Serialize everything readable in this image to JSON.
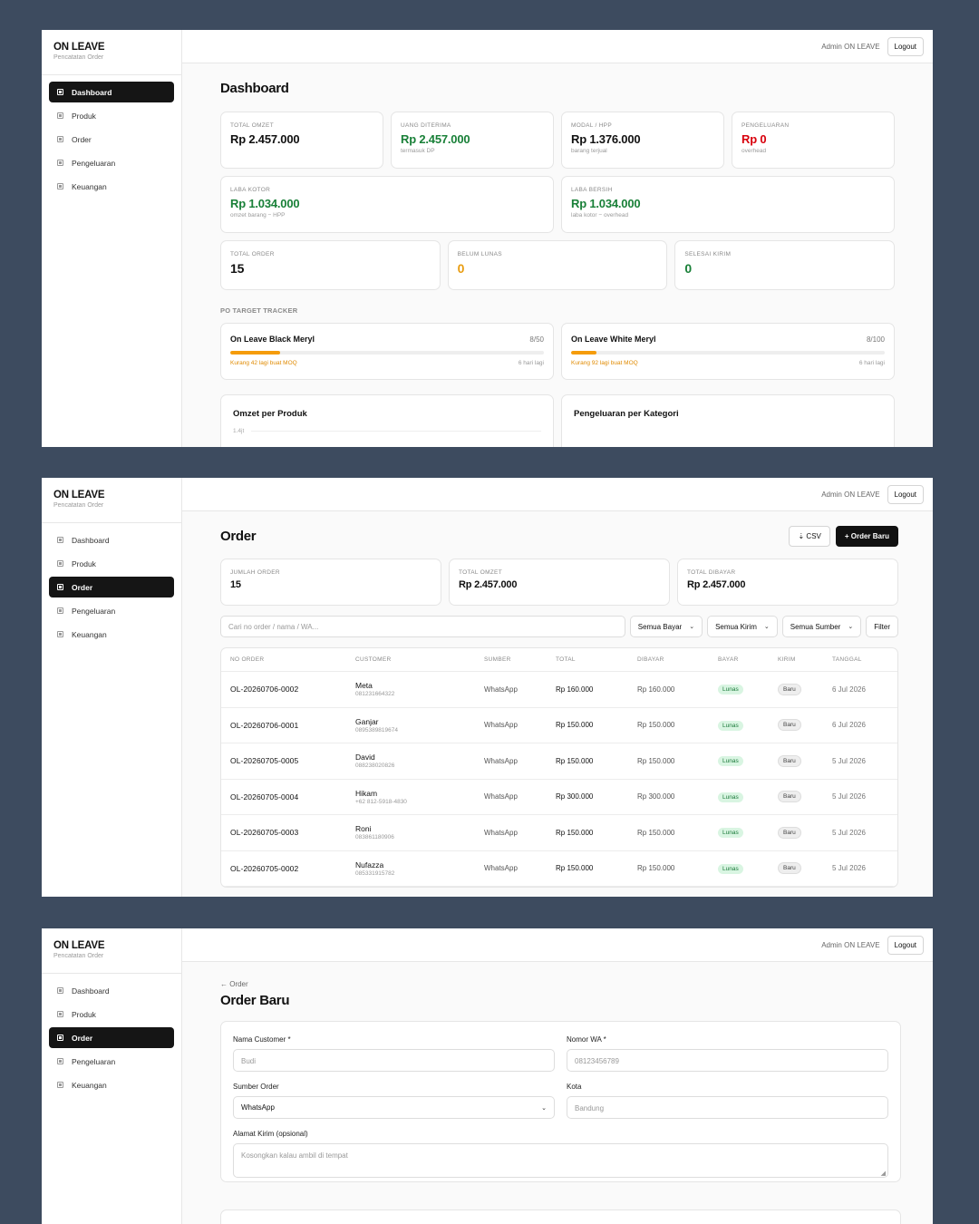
{
  "brand": {
    "name": "ON LEAVE",
    "subtitle": "Pencatatan Order"
  },
  "nav": [
    "Dashboard",
    "Produk",
    "Order",
    "Pengeluaran",
    "Keuangan"
  ],
  "topbar": {
    "admin": "Admin ON LEAVE",
    "logout": "Logout"
  },
  "dashboard": {
    "title": "Dashboard",
    "stats_row1": [
      {
        "label": "TOTAL OMZET",
        "value": "Rp 2.457.000",
        "sub": "",
        "color": "#111111"
      },
      {
        "label": "UANG DITERIMA",
        "value": "Rp 2.457.000",
        "sub": "termasuk DP",
        "color": "#198038"
      },
      {
        "label": "MODAL / HPP",
        "value": "Rp 1.376.000",
        "sub": "barang terjual",
        "color": "#111111"
      },
      {
        "label": "PENGELUARAN",
        "value": "Rp 0",
        "sub": "overhead",
        "color": "#d8000c"
      }
    ],
    "stats_row2": [
      {
        "label": "LABA KOTOR",
        "value": "Rp 1.034.000",
        "sub": "omzet barang − HPP",
        "color": "#198038"
      },
      {
        "label": "LABA BERSIH",
        "value": "Rp 1.034.000",
        "sub": "laba kotor − overhead",
        "color": "#198038"
      }
    ],
    "stats_row3": [
      {
        "label": "TOTAL ORDER",
        "value": "15",
        "color": "#111111"
      },
      {
        "label": "BELUM LUNAS",
        "value": "0",
        "color": "#e89c10"
      },
      {
        "label": "SELESAI KIRIM",
        "value": "0",
        "color": "#198038"
      }
    ],
    "po_section": "PO TARGET TRACKER",
    "po": [
      {
        "name": "On Leave Black Meryl",
        "count": "8/50",
        "progress": 0.16,
        "note": "Kurang 42 lagi buat MOQ",
        "days": "6 hari lagi"
      },
      {
        "name": "On Leave White Meryl",
        "count": "8/100",
        "progress": 0.08,
        "note": "Kurang 92 lagi buat MOQ",
        "days": "6 hari lagi"
      }
    ],
    "charts": [
      {
        "title": "Omzet per Produk",
        "tick": "1.4jt"
      },
      {
        "title": "Pengeluaran per Kategori",
        "tick": ""
      }
    ]
  },
  "order": {
    "title": "Order",
    "csv": "⇣ CSV",
    "new": "+ Order Baru",
    "stats": [
      {
        "label": "JUMLAH ORDER",
        "value": "15"
      },
      {
        "label": "TOTAL OMZET",
        "value": "Rp 2.457.000"
      },
      {
        "label": "TOTAL DIBAYAR",
        "value": "Rp 2.457.000"
      }
    ],
    "search_placeholder": "Cari no order / nama / WA...",
    "filters": [
      "Semua Bayar",
      "Semua Kirim",
      "Semua Sumber"
    ],
    "filter_button": "Filter",
    "columns": [
      "NO ORDER",
      "CUSTOMER",
      "SUMBER",
      "TOTAL",
      "DIBAYAR",
      "BAYAR",
      "KIRIM",
      "TANGGAL"
    ],
    "rows": [
      {
        "no": "OL-20260706-0002",
        "name": "Meta",
        "phone": "081231664322",
        "source": "WhatsApp",
        "total": "Rp 160.000",
        "paid": "Rp 160.000",
        "pay": "Lunas",
        "ship": "Baru",
        "date": "6 Jul 2026"
      },
      {
        "no": "OL-20260706-0001",
        "name": "Ganjar",
        "phone": "0895389819674",
        "source": "WhatsApp",
        "total": "Rp 150.000",
        "paid": "Rp 150.000",
        "pay": "Lunas",
        "ship": "Baru",
        "date": "6 Jul 2026"
      },
      {
        "no": "OL-20260705-0005",
        "name": "David",
        "phone": "088238020826",
        "source": "WhatsApp",
        "total": "Rp 150.000",
        "paid": "Rp 150.000",
        "pay": "Lunas",
        "ship": "Baru",
        "date": "5 Jul 2026"
      },
      {
        "no": "OL-20260705-0004",
        "name": "Hikam",
        "phone": "+62 812-5918-4830",
        "source": "WhatsApp",
        "total": "Rp 300.000",
        "paid": "Rp 300.000",
        "pay": "Lunas",
        "ship": "Baru",
        "date": "5 Jul 2026"
      },
      {
        "no": "OL-20260705-0003",
        "name": "Roni",
        "phone": "083861180906",
        "source": "WhatsApp",
        "total": "Rp 150.000",
        "paid": "Rp 150.000",
        "pay": "Lunas",
        "ship": "Baru",
        "date": "5 Jul 2026"
      },
      {
        "no": "OL-20260705-0002",
        "name": "Nufazza",
        "phone": "085331915782",
        "source": "WhatsApp",
        "total": "Rp 150.000",
        "paid": "Rp 150.000",
        "pay": "Lunas",
        "ship": "Baru",
        "date": "5 Jul 2026"
      }
    ]
  },
  "form": {
    "back": "← Order",
    "title": "Order Baru",
    "customer_label": "Nama Customer *",
    "customer_placeholder": "Budi",
    "wa_label": "Nomor WA *",
    "wa_placeholder": "08123456789",
    "source_label": "Sumber Order",
    "source_value": "WhatsApp",
    "city_label": "Kota",
    "city_placeholder": "Bandung",
    "address_label": "Alamat Kirim (opsional)",
    "address_placeholder": "Kosongkan kalau ambil di tempat"
  }
}
